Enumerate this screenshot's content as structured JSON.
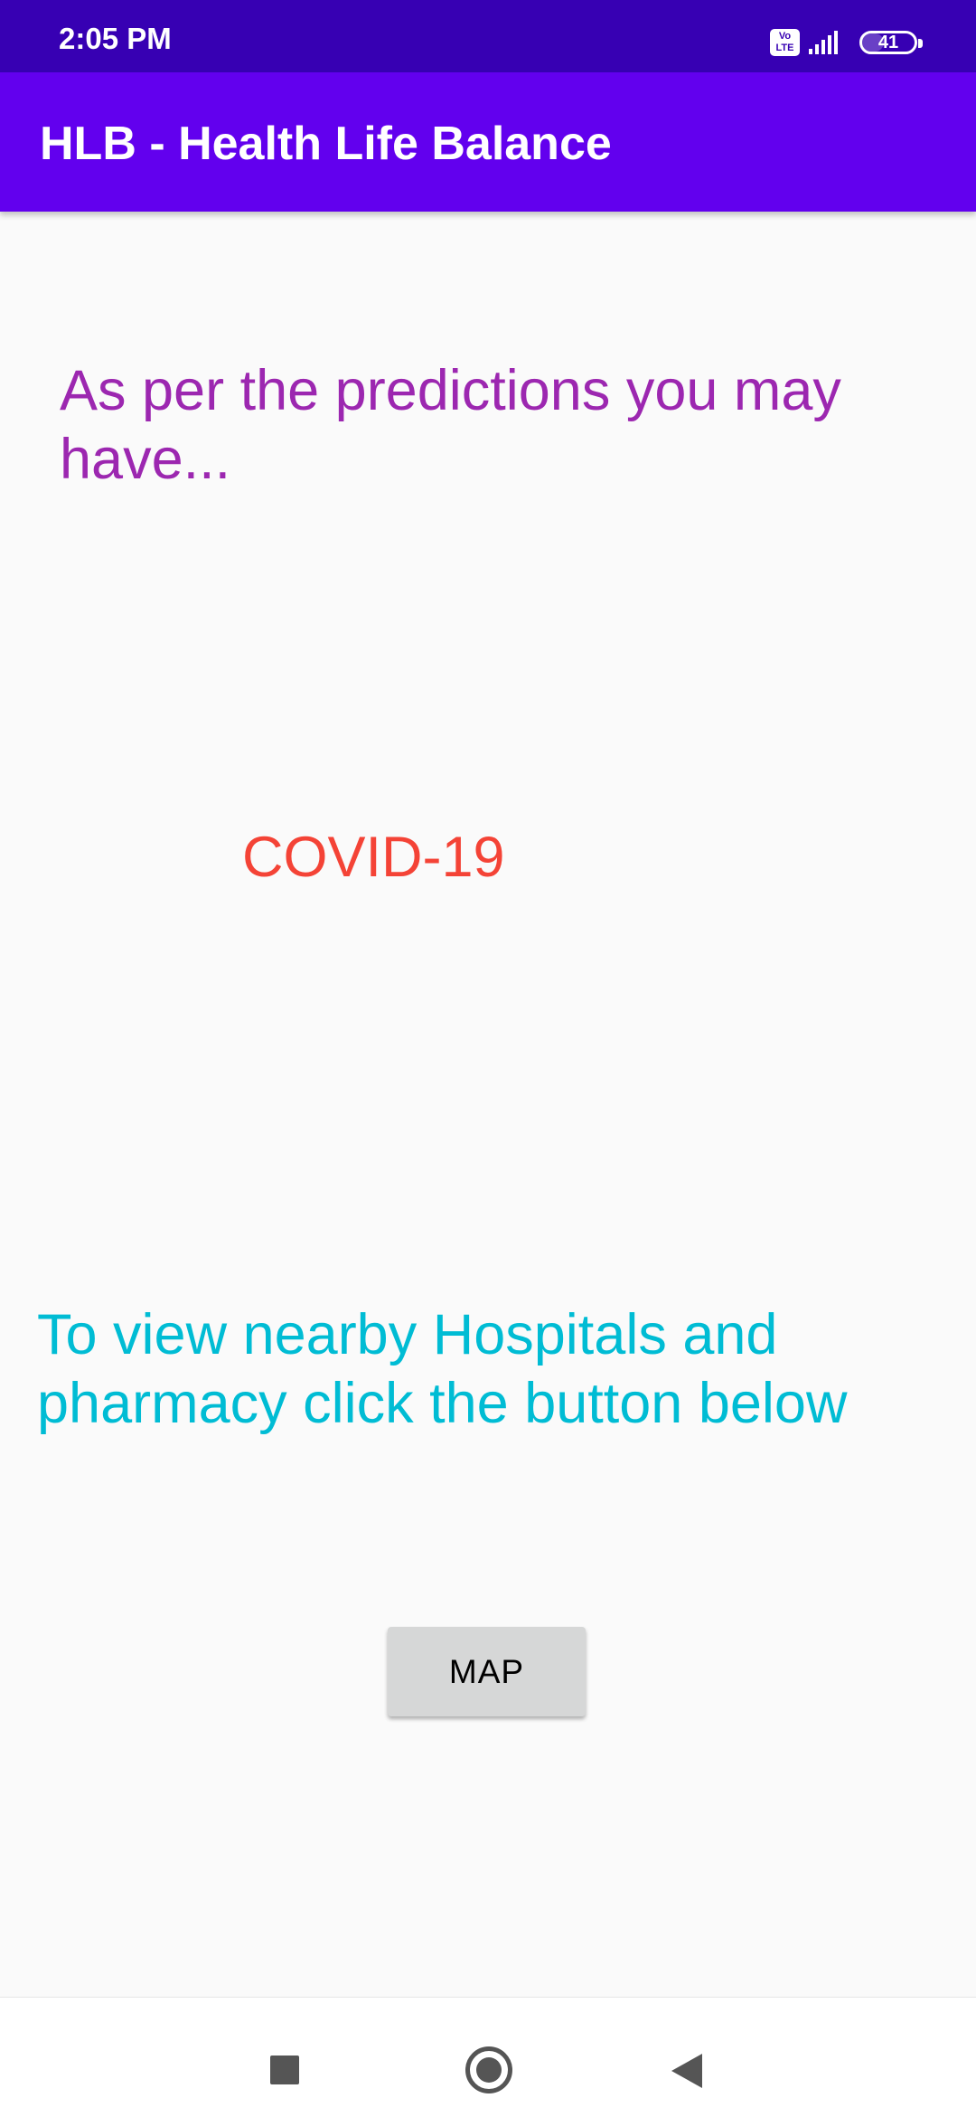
{
  "status_bar": {
    "time": "2:05 PM",
    "network_badge": "Vo\nLTE",
    "signal_icon": "cellular-signal-icon",
    "battery_level": "41",
    "background_color": "#3700b3"
  },
  "app_bar": {
    "title": "HLB - Health Life Balance",
    "background_color": "#6200ee"
  },
  "content": {
    "prediction_heading": "As per the predictions you may have...",
    "predicted_disease": "COVID-19",
    "map_instruction": "To view nearby Hospitals and pharmacy click the button below",
    "map_button_label": "MAP"
  },
  "colors": {
    "heading": "#9c27b0",
    "disease": "#f44336",
    "instruction": "#00bcd4",
    "button_background": "#d6d7d7",
    "screen_background": "#fafafa"
  },
  "navigation_bar": {
    "recent_apps_icon": "square-icon",
    "home_icon": "circle-icon",
    "back_icon": "triangle-back-icon"
  }
}
